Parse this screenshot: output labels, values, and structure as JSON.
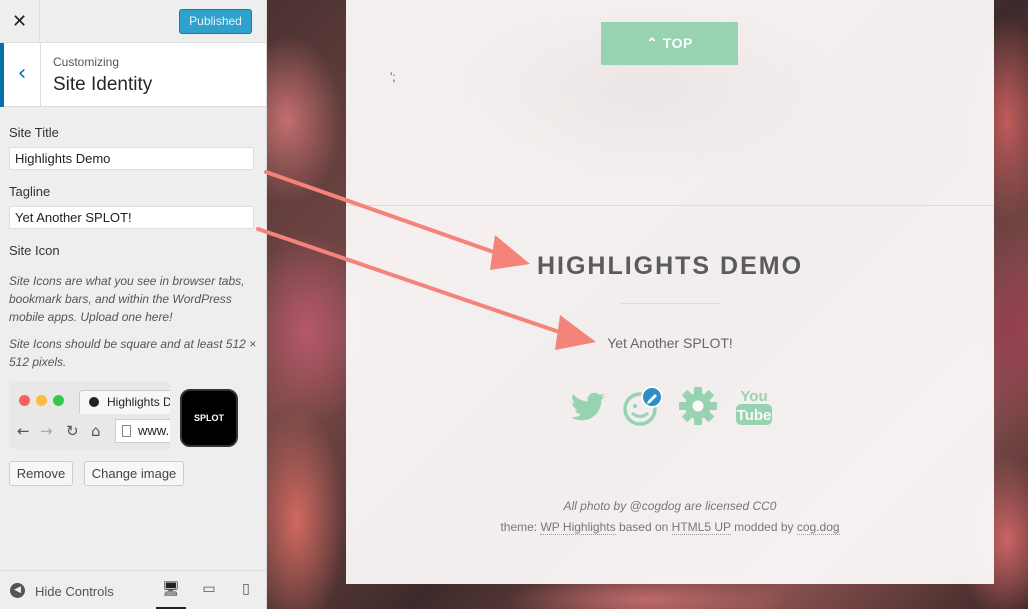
{
  "header": {
    "close_label": "✕",
    "publish_label": "Published"
  },
  "section": {
    "breadcrumb": "Customizing",
    "title": "Site Identity",
    "back_icon": "‹"
  },
  "fields": {
    "site_title_label": "Site Title",
    "site_title_value": "Highlights Demo",
    "tagline_label": "Tagline",
    "tagline_value": "Yet Another SPLOT!",
    "site_icon_label": "Site Icon",
    "site_icon_desc1": "Site Icons are what you see in browser tabs, bookmark bars, and within the WordPress mobile apps. Upload one here!",
    "site_icon_desc2": "Site Icons should be square and at least 512 × 512 pixels."
  },
  "browser_preview": {
    "tab_title": "Highlights Demo",
    "url_text": "www.",
    "icon_text": "SPLOT"
  },
  "buttons": {
    "remove": "Remove",
    "change_image": "Change image"
  },
  "footer": {
    "hide_controls": "Hide Controls"
  },
  "preview": {
    "top_button": "⌃ TOP",
    "stray_mark": "';",
    "site_title": "HIGHLIGHTS DEMO",
    "tagline": "Yet Another SPLOT!",
    "social_icons": [
      "twitter-icon",
      "splot-edit-icon",
      "gear-icon",
      "youtube-icon"
    ],
    "credit_line1": "All photo by @cogdog are licensed CC0",
    "credit_prefix": "theme: ",
    "credit_link1": "WP Highlights",
    "credit_mid1": " based on ",
    "credit_link2": "HTML5 UP",
    "credit_mid2": " modded by ",
    "credit_link3": "cog.dog"
  },
  "colors": {
    "accent": "#97d3b0",
    "publish_blue": "#2ea2cc",
    "arrow": "#f4837a"
  }
}
